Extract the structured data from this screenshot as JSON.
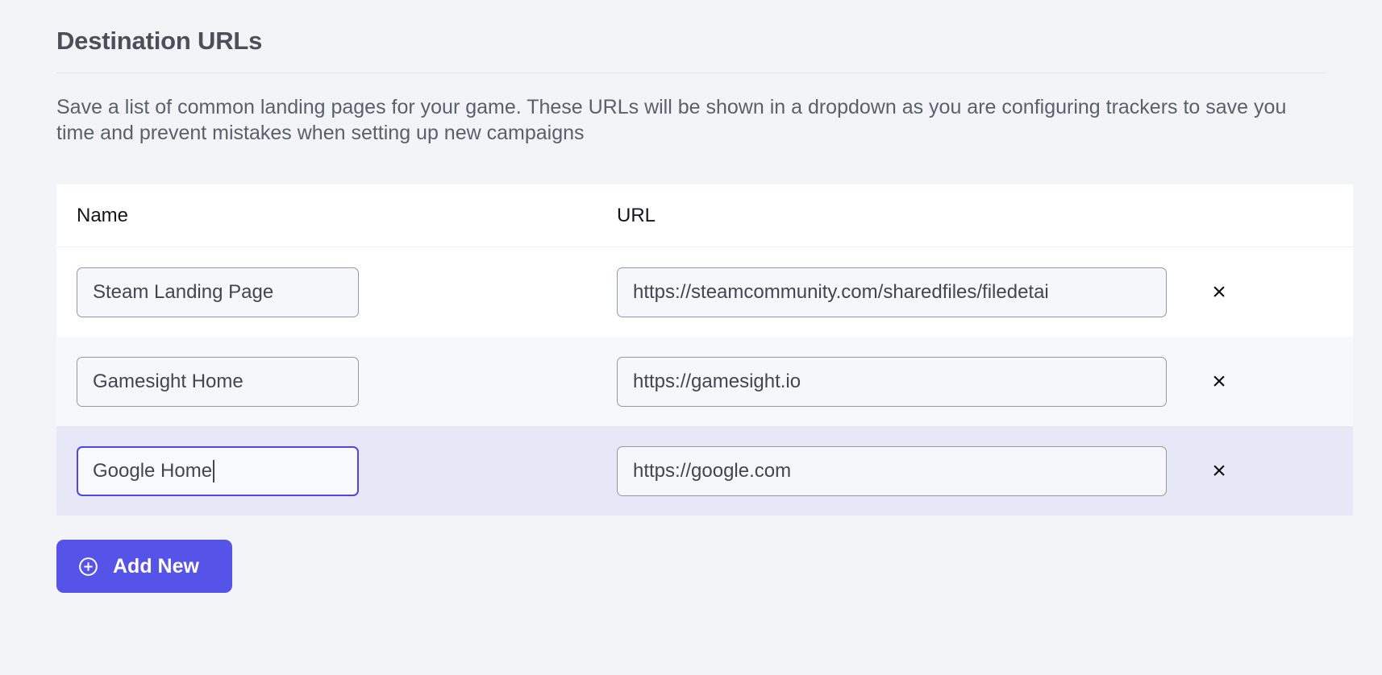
{
  "page": {
    "title": "Destination URLs",
    "description": "Save a list of common landing pages for your game. These URLs will be shown in a dropdown as you are configuring trackers to save you time and prevent mistakes when setting up new campaigns"
  },
  "table": {
    "columns": {
      "name": "Name",
      "url": "URL"
    },
    "rows": [
      {
        "name": "Steam Landing Page",
        "url": "https://steamcommunity.com/sharedfiles/filedetai",
        "delete_label": "×",
        "state": "default"
      },
      {
        "name": "Gamesight Home",
        "url": "https://gamesight.io",
        "delete_label": "×",
        "state": "striped"
      },
      {
        "name": "Google Home",
        "url": "https://google.com",
        "delete_label": "×",
        "state": "active"
      }
    ]
  },
  "actions": {
    "add_new_label": "Add New",
    "add_new_icon": "circle-plus-icon"
  },
  "colors": {
    "page_background": "#f2f4f8",
    "accent": "#5553e8",
    "focus_border": "#4f46e5",
    "active_row": "#e6e8f7",
    "striped_row": "#f7f8fb",
    "input_border": "#9499a3",
    "title_text": "#4a4f58",
    "body_text": "#5a606b"
  }
}
